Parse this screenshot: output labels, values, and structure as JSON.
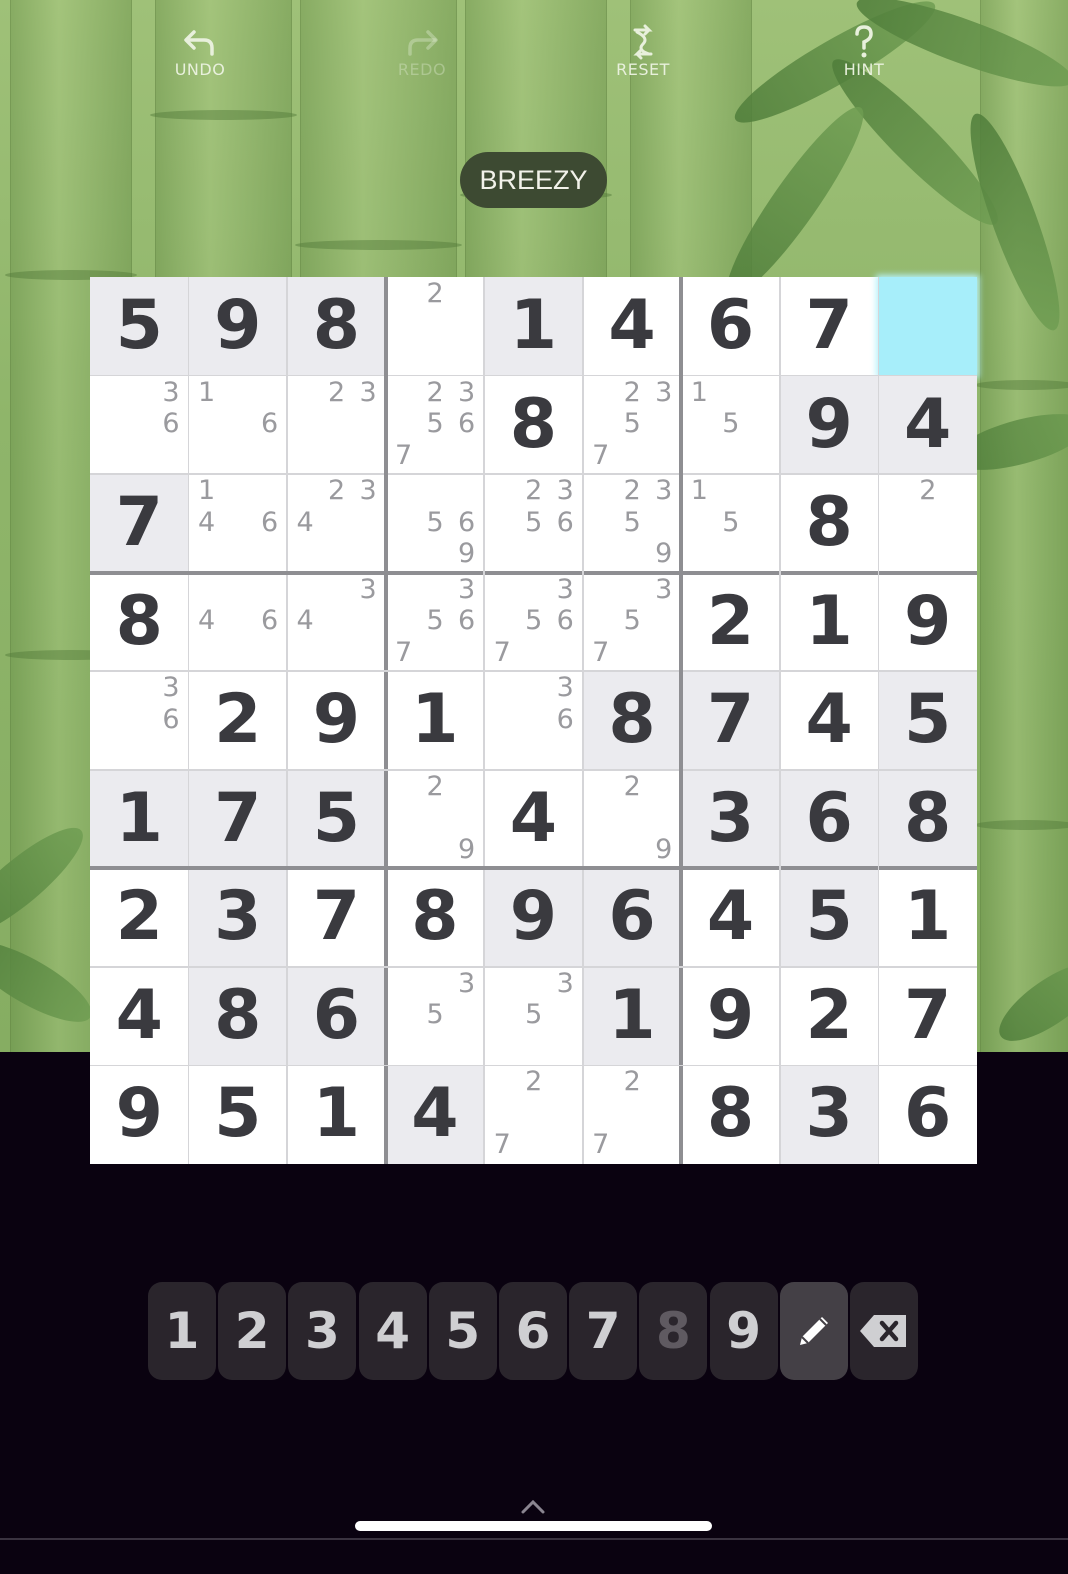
{
  "toolbar": {
    "undo": {
      "label": "UNDO",
      "icon": "undo-arrow-icon"
    },
    "redo": {
      "label": "REDO",
      "icon": "redo-arrow-icon",
      "enabled": false
    },
    "reset": {
      "label": "RESET",
      "icon": "reset-swap-icon"
    },
    "hint": {
      "label": "HINT",
      "icon": "question-mark-icon"
    }
  },
  "difficulty": "BREEZY",
  "board": {
    "selected": [
      0,
      8
    ],
    "values": [
      [
        5,
        9,
        8,
        0,
        1,
        4,
        6,
        7,
        0
      ],
      [
        0,
        0,
        0,
        0,
        8,
        0,
        0,
        9,
        4
      ],
      [
        7,
        0,
        0,
        0,
        0,
        0,
        0,
        8,
        0
      ],
      [
        8,
        0,
        0,
        0,
        0,
        0,
        2,
        1,
        9
      ],
      [
        0,
        2,
        9,
        1,
        0,
        8,
        7,
        4,
        5
      ],
      [
        1,
        7,
        5,
        0,
        4,
        0,
        3,
        6,
        8
      ],
      [
        2,
        3,
        7,
        8,
        9,
        6,
        4,
        5,
        1
      ],
      [
        4,
        8,
        6,
        0,
        0,
        1,
        9,
        2,
        7
      ],
      [
        9,
        5,
        1,
        4,
        0,
        0,
        8,
        3,
        6
      ]
    ],
    "shaded": [
      [
        1,
        1,
        1,
        0,
        1,
        0,
        0,
        0,
        0
      ],
      [
        0,
        0,
        0,
        0,
        0,
        0,
        0,
        1,
        1
      ],
      [
        1,
        0,
        0,
        0,
        0,
        0,
        0,
        0,
        0
      ],
      [
        0,
        0,
        0,
        0,
        0,
        0,
        0,
        0,
        0
      ],
      [
        0,
        0,
        0,
        0,
        0,
        1,
        1,
        0,
        1
      ],
      [
        1,
        1,
        1,
        0,
        0,
        0,
        1,
        1,
        1
      ],
      [
        0,
        1,
        0,
        0,
        1,
        1,
        0,
        1,
        0
      ],
      [
        0,
        1,
        1,
        0,
        0,
        1,
        0,
        0,
        0
      ],
      [
        0,
        0,
        0,
        1,
        0,
        0,
        0,
        1,
        0
      ]
    ],
    "candidates": {
      "0,3": [
        2
      ],
      "1,0": [
        3,
        6
      ],
      "1,1": [
        1,
        6
      ],
      "1,2": [
        2,
        3
      ],
      "1,3": [
        2,
        3,
        5,
        6,
        7
      ],
      "1,5": [
        2,
        3,
        5,
        7
      ],
      "1,6": [
        1,
        5
      ],
      "2,1": [
        1,
        4,
        6
      ],
      "2,2": [
        2,
        3,
        4
      ],
      "2,3": [
        5,
        6,
        9
      ],
      "2,4": [
        2,
        3,
        5,
        6
      ],
      "2,5": [
        2,
        3,
        5,
        9
      ],
      "2,6": [
        1,
        5
      ],
      "2,8": [
        2
      ],
      "3,1": [
        4,
        6
      ],
      "3,2": [
        3,
        4
      ],
      "3,3": [
        3,
        5,
        6,
        7
      ],
      "3,4": [
        3,
        5,
        6,
        7
      ],
      "3,5": [
        3,
        5,
        7
      ],
      "4,0": [
        3,
        6
      ],
      "4,4": [
        3,
        6
      ],
      "5,3": [
        2,
        9
      ],
      "5,5": [
        2,
        9
      ],
      "7,3": [
        3,
        5
      ],
      "7,4": [
        3,
        5
      ],
      "8,4": [
        2,
        7
      ],
      "8,5": [
        2,
        7
      ]
    }
  },
  "keypad": {
    "keys": [
      "1",
      "2",
      "3",
      "4",
      "5",
      "6",
      "7",
      "8",
      "9"
    ],
    "dimmed": [
      "8"
    ],
    "pencil": {
      "icon": "pencil-icon",
      "active": true
    },
    "erase": {
      "icon": "backspace-icon"
    }
  },
  "colors": {
    "selected_cell": "#a7eefa",
    "shaded_cell": "#ebebef",
    "digit": "#3a3a3f",
    "candidate": "#9a9a9e",
    "badge": "#3d4a32"
  }
}
